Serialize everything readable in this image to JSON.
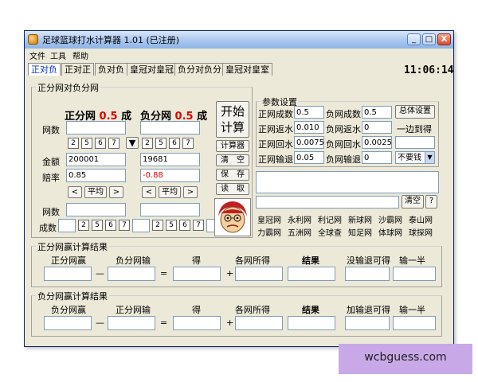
{
  "window": {
    "title": "足球篮球打水计算器 1.01 (已注册)",
    "controls": {
      "minimize": "_",
      "maximize": "□",
      "close": "X"
    }
  },
  "menu": [
    "文件",
    "工具",
    "帮助"
  ],
  "tabs": [
    "正对负",
    "正对正",
    "负对负",
    "皇冠对皇冠",
    "负分对负分",
    "皇冠对皇室"
  ],
  "clock": "11:06:14",
  "main_group": {
    "title": "正分网对负分网",
    "left_header": {
      "prefix": "正分网 ",
      "value": "0.5",
      "suffix": " 成"
    },
    "right_header": {
      "prefix": "负分网 ",
      "value": "0.5",
      "suffix": " 成"
    },
    "label_wangshu": "网数",
    "label_jine": "金额",
    "label_peilv": "赔率",
    "label_wangshu2": "网数",
    "label_chengshu": "成数",
    "quick_values": [
      "2",
      "5",
      "6",
      "7"
    ],
    "arrow": "▼",
    "left_amount": "200001",
    "right_amount": "19681",
    "left_odds": "0.85",
    "right_odds": "-0.88",
    "btn_prev": "<",
    "btn_avg": "平均",
    "btn_next": ">"
  },
  "actions": {
    "start_line1": "开始",
    "start_line2": "计算",
    "calculator": "计算器",
    "clear": "清　空",
    "save": "保　存",
    "load": "读　取"
  },
  "params": {
    "title": "参数设置",
    "rows": [
      {
        "l1": "正网成数",
        "v1": "0.5",
        "l2": "负网成数",
        "v2": "0.5"
      },
      {
        "l1": "正网返水",
        "v1": "0.010",
        "l2": "负网返水",
        "v2": "0"
      },
      {
        "l1": "正网回水",
        "v1": "0.0075",
        "l2": "负网回水",
        "v2": "0.0025"
      },
      {
        "l1": "正网输退",
        "v1": "0.05",
        "l2": "负网输退",
        "v2": "0"
      }
    ],
    "overall_btn": "总体设置",
    "yibian_label": "一边到得",
    "dropdown_value": "不要钱",
    "clear_btn": "清空",
    "help_btn": "?"
  },
  "links": [
    "皇冠网",
    "永利网",
    "利记网",
    "新球网",
    "沙霸网",
    "泰山网",
    "力霸网",
    "五洲网",
    "全球查",
    "知足网",
    "体球网",
    "球探网"
  ],
  "result1": {
    "title": "正分网赢计算结果",
    "h1": "正分网赢",
    "h2": "负分网输",
    "h3": "得",
    "h4": "各网所得",
    "h5": "结果",
    "h6": "没输退可得",
    "h7": "输一半",
    "minus": "—",
    "equals": "=",
    "plus": "+"
  },
  "result2": {
    "title": "负分网赢计算结果",
    "h1": "负分网赢",
    "h2": "正分网输",
    "h3": "得",
    "h4": "各网所得",
    "h5": "结果",
    "h6": "加输退可得",
    "h7": "输一半",
    "minus": "—",
    "equals": "=",
    "plus": "+"
  },
  "watermark": "wcbguess.com"
}
